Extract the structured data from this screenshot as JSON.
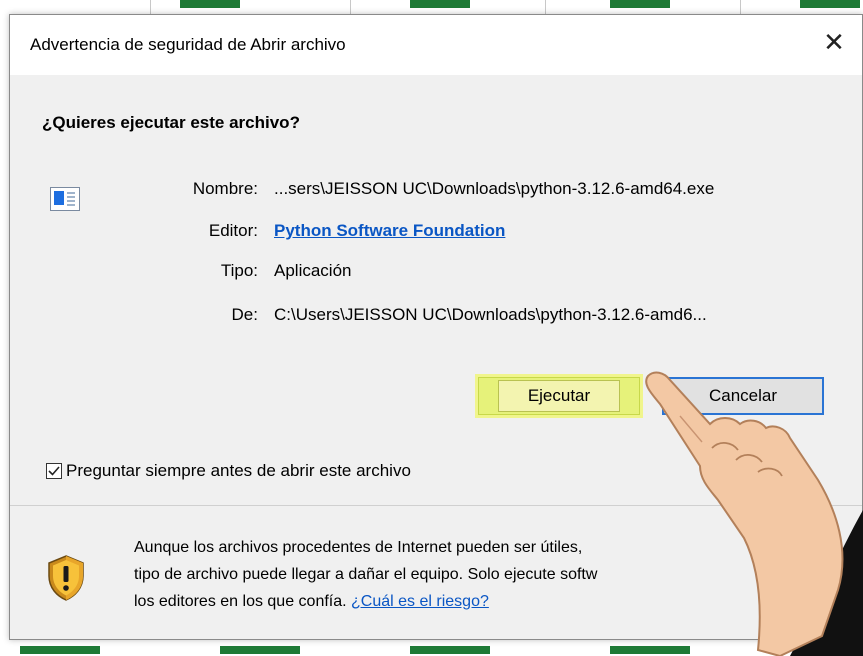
{
  "window": {
    "title": "Advertencia de seguridad de Abrir archivo",
    "close_glyph": "✕"
  },
  "question": "¿Quieres ejecutar este archivo?",
  "details": {
    "name_label": "Nombre:",
    "name_value": "...sers\\JEISSON UC\\Downloads\\python-3.12.6-amd64.exe",
    "publisher_label": "Editor:",
    "publisher_value": "Python Software Foundation",
    "type_label": "Tipo:",
    "type_value": "Aplicación",
    "from_label": "De:",
    "from_value": "C:\\Users\\JEISSON UC\\Downloads\\python-3.12.6-amd6..."
  },
  "buttons": {
    "run_label": "Ejecutar",
    "cancel_label": "Cancelar"
  },
  "checkbox": {
    "label": "Preguntar siempre antes de abrir este archivo",
    "checked": true
  },
  "footer": {
    "line1": "Aunque los archivos procedentes de Internet pueden ser útiles,",
    "line2": "tipo de archivo puede llegar a dañar el equipo. Solo ejecute softw",
    "line3_prefix": "los editores en los que confía. ",
    "risk_link": "¿Cuál es el riesgo?"
  },
  "colors": {
    "accent": "#2a74d4",
    "link": "#0a56c4",
    "highlight": "#e6f27a",
    "icons": [
      "file-icon",
      "shield-icon",
      "close-icon",
      "checkmark-icon",
      "pointing-hand-icon"
    ]
  }
}
